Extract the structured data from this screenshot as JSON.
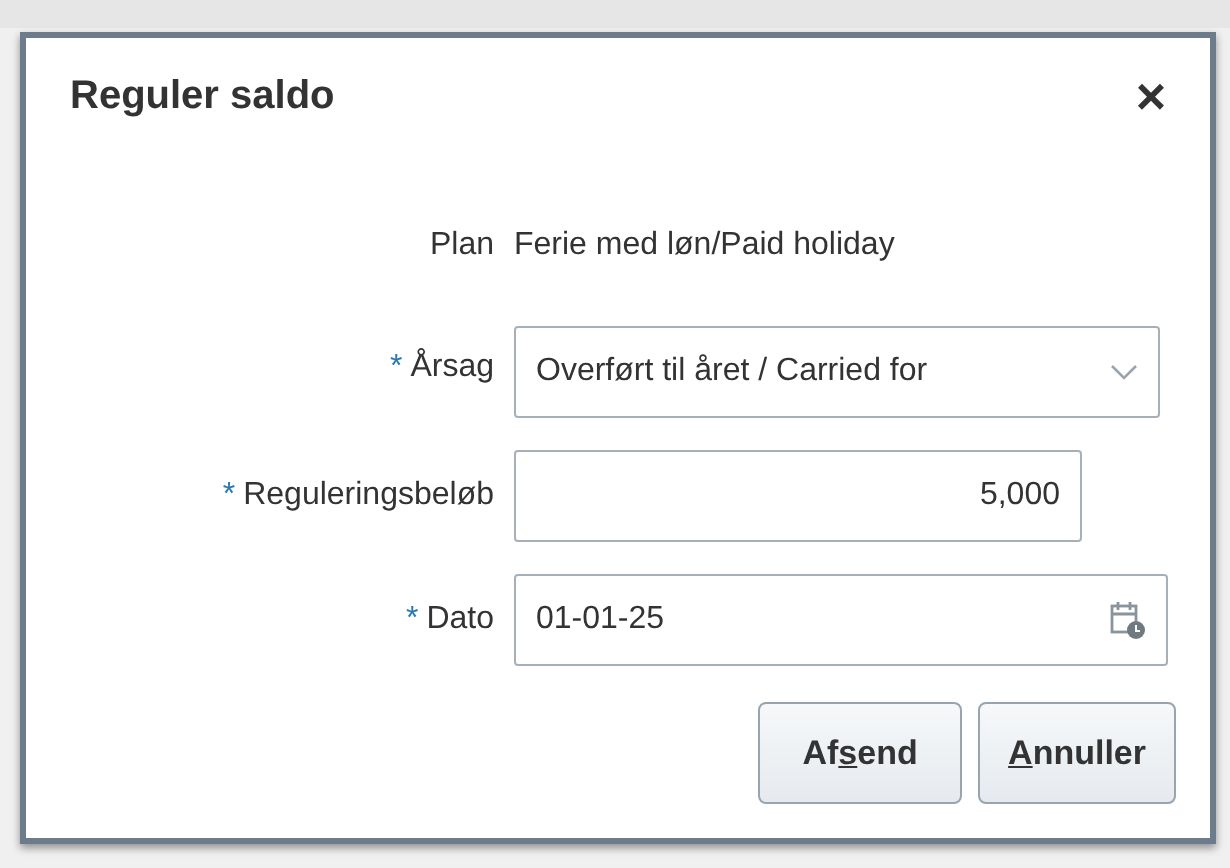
{
  "dialog": {
    "title": "Reguler saldo",
    "close": "×"
  },
  "fields": [
    {
      "kind": "text",
      "label": "Plan",
      "required": false,
      "value": "Ferie med løn/Paid holiday"
    },
    {
      "kind": "select",
      "label": "Årsag",
      "required": true,
      "value": "Overført til året / Carried for"
    },
    {
      "kind": "number",
      "label": "Reguleringsbeløb",
      "required": true,
      "value": "5,000"
    },
    {
      "kind": "date",
      "label": "Dato",
      "required": true,
      "value": "01-01-25"
    }
  ],
  "required_mark": "*",
  "buttons": [
    {
      "before": "Af",
      "key": "s",
      "after": "end"
    },
    {
      "key": "A",
      "after": "nnuller"
    }
  ]
}
